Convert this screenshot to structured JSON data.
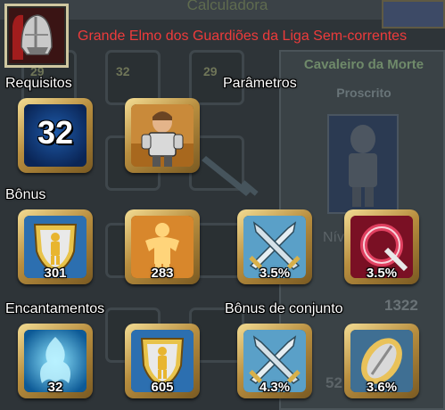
{
  "background": {
    "window_title": "Calculadora",
    "slot_levels": [
      "29",
      "32",
      "29"
    ],
    "class_name": "Cavaleiro da Morte",
    "subclass": "Proscrito",
    "level_label_fragment": "Nív",
    "stat_value": "1322",
    "stat_value_fragment": "52"
  },
  "item": {
    "name": "Grande Elmo dos Guardiões da Liga Sem-correntes",
    "icon": "helmet-icon",
    "name_color": "#ee3b3b"
  },
  "requirements": {
    "label": "Requisitos",
    "level": "32",
    "class_icon": "knight-character-icon"
  },
  "parameters": {
    "label": "Parâmetros"
  },
  "bonus": {
    "label": "Bônus",
    "items": [
      {
        "icon": "shield-figure-icon",
        "value": "301"
      },
      {
        "icon": "strength-figure-icon",
        "value": "283"
      },
      {
        "icon": "crossed-swords-icon",
        "value": "3.5%"
      },
      {
        "icon": "red-ring-icon",
        "value": "3.5%"
      }
    ]
  },
  "enchantments": {
    "label": "Encantamentos",
    "items": [
      {
        "icon": "blue-spirit-icon",
        "value": "32"
      },
      {
        "icon": "shield-figure-icon",
        "value": "605"
      }
    ]
  },
  "set_bonus": {
    "label": "Bônus de conjunto",
    "items": [
      {
        "icon": "crossed-swords-icon",
        "value": "4.3%"
      },
      {
        "icon": "blade-icon",
        "value": "3.6%"
      }
    ]
  },
  "colors": {
    "tile_gold": "#c9a24f",
    "background": "#2e3438"
  }
}
